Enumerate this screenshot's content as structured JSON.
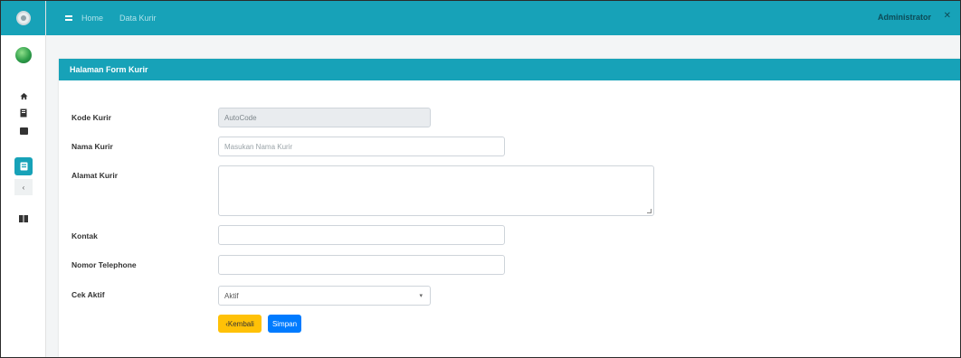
{
  "topbar": {
    "crumb_home": "Home",
    "crumb_page": "Data Kurir",
    "user": "Administrator",
    "close_glyph": "✕"
  },
  "sidebar": {
    "icons": [
      "logo-icon",
      "avatar",
      "home-icon",
      "book-icon",
      "folder-icon",
      "form-icon",
      "chevron-icon",
      "grid-icon"
    ],
    "sub_glyph": "‹"
  },
  "card": {
    "title": "Halaman Form Kurir"
  },
  "form": {
    "kode": {
      "label": "Kode Kurir",
      "value": "AutoCode"
    },
    "nama": {
      "label": "Nama Kurir",
      "placeholder": "Masukan Nama Kurir"
    },
    "alamat": {
      "label": "Alamat Kurir"
    },
    "kontak": {
      "label": "Kontak"
    },
    "telp": {
      "label": "Nomor Telephone"
    },
    "status": {
      "label": "Cek Aktif",
      "selected": "Aktif",
      "arrow": "▾"
    }
  },
  "buttons": {
    "back": "‹Kembali",
    "save": "Simpan"
  },
  "colors": {
    "primary": "#17a2b8",
    "warning": "#ffc107",
    "blue": "#007bff"
  }
}
